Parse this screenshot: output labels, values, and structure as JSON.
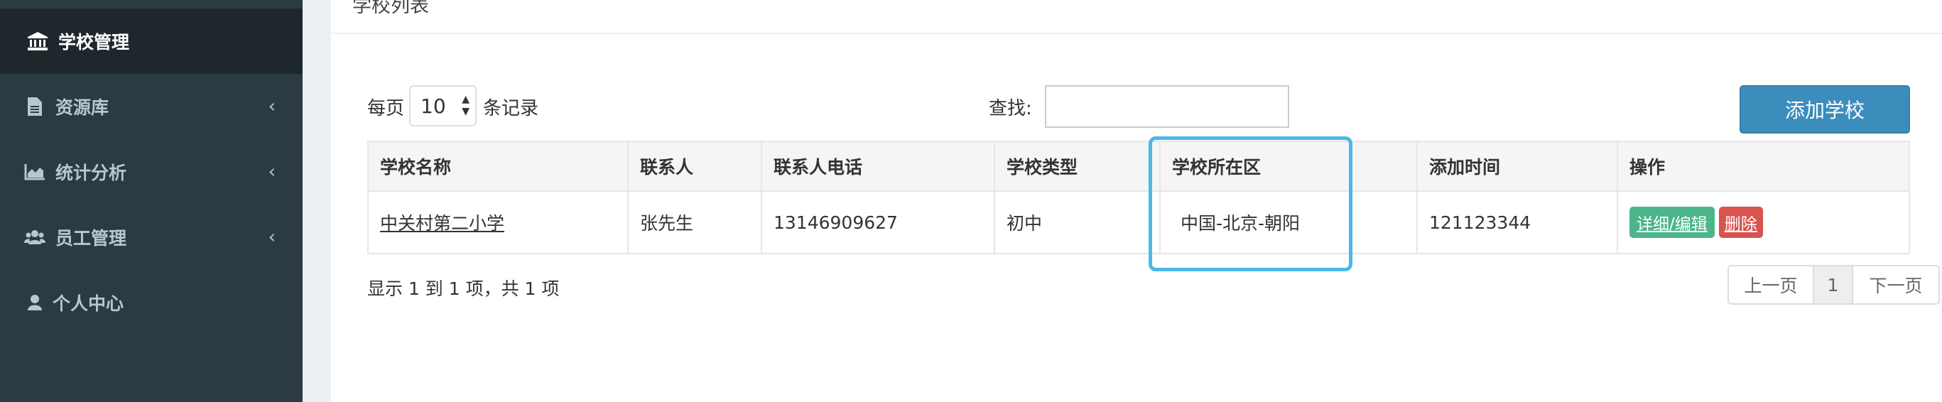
{
  "sidebar": {
    "items": [
      {
        "label": "学校管理",
        "icon": "bank-icon",
        "active": true
      },
      {
        "label": "资源库",
        "icon": "file-icon"
      },
      {
        "label": "统计分析",
        "icon": "area-chart-icon"
      },
      {
        "label": "员工管理",
        "icon": "users-icon"
      },
      {
        "label": "个人中心",
        "icon": "user-icon"
      }
    ],
    "chevron": "‹"
  },
  "box": {
    "title": "学校列表"
  },
  "controls": {
    "per_page_prefix": "每页",
    "per_page_value": "10",
    "per_page_suffix": "条记录",
    "search_label": "查找:",
    "search_value": "",
    "add_button": "添加学校"
  },
  "table": {
    "headers": [
      "学校名称",
      "联系人",
      "联系人电话",
      "学校类型",
      "学校所在区",
      "添加时间",
      "操作"
    ],
    "rows": [
      {
        "name": "中关村第二小学",
        "contact": "张先生",
        "phone": "13146909627",
        "type": "初中",
        "district": "中国-北京-朝阳",
        "added": "121123344",
        "edit_label": "详细/编辑",
        "delete_label": "删除"
      }
    ]
  },
  "footer": {
    "info": "显示 1 到 1 项，共 1 项",
    "prev": "上一页",
    "page": "1",
    "next": "下一页"
  },
  "colors": {
    "sidebar_bg": "#2c3b41",
    "sidebar_active": "#1e282c",
    "primary": "#3c8dbc",
    "success": "#4cb58a",
    "danger": "#d9534f",
    "highlight": "#4db8e8"
  }
}
